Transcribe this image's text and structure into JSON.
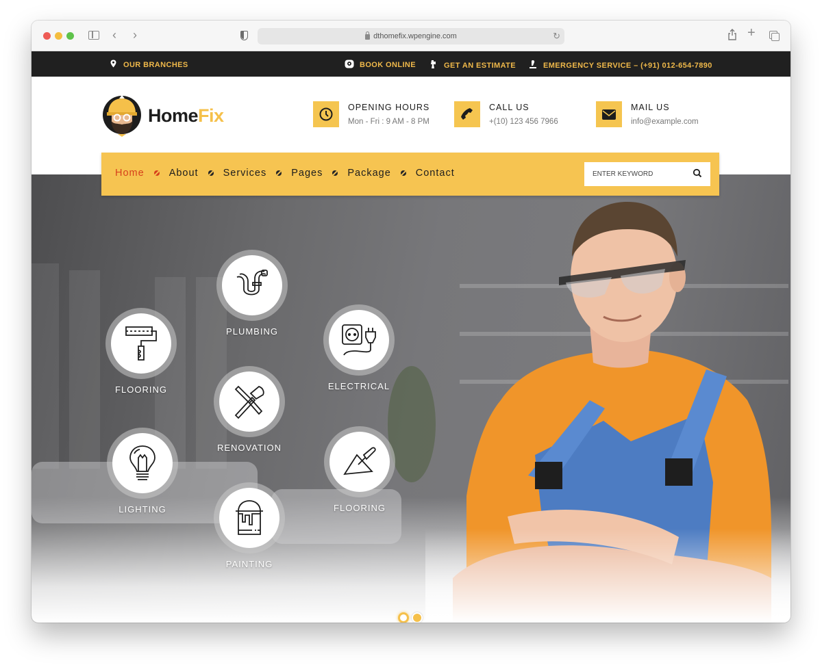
{
  "browser": {
    "url": "dthomefix.wpengine.com",
    "icons": [
      "close-dot",
      "minimize-dot",
      "zoom-dot",
      "sidebar-icon",
      "back-icon",
      "forward-icon",
      "shield-icon",
      "lock-icon",
      "reload-icon",
      "share-icon",
      "new-tab-icon",
      "tab-overview-icon"
    ]
  },
  "topbar": {
    "branches": "OUR BRANCHES",
    "book": "BOOK ONLINE",
    "estimate": "GET AN ESTIMATE",
    "emergency": "EMERGENCY SERVICE – (+91) 012-654-7890"
  },
  "header": {
    "logo_main": "Home",
    "logo_accent": "Fix",
    "info": [
      {
        "title": "OPENING HOURS",
        "sub": "Mon - Fri : 9 AM - 8 PM",
        "icon": "clock-icon"
      },
      {
        "title": "CALL US",
        "sub": "+(10) 123 456 7966",
        "icon": "phone-icon"
      },
      {
        "title": "MAIL US",
        "sub": "info@example.com",
        "icon": "mail-icon"
      }
    ]
  },
  "nav": {
    "items": [
      {
        "label": "Home",
        "active": true
      },
      {
        "label": "About"
      },
      {
        "label": "Services"
      },
      {
        "label": "Pages"
      },
      {
        "label": "Package"
      },
      {
        "label": "Contact"
      }
    ],
    "search_placeholder": "ENTER KEYWORD"
  },
  "services": [
    {
      "label": "PLUMBING",
      "icon": "pipe-icon"
    },
    {
      "label": "FLOORING",
      "icon": "paint-roller-icon"
    },
    {
      "label": "ELECTRICAL",
      "icon": "socket-plug-icon"
    },
    {
      "label": "RENOVATION",
      "icon": "tools-icon"
    },
    {
      "label": "LIGHTING",
      "icon": "light-bulb-icon"
    },
    {
      "label": "FLOORING",
      "icon": "trowel-icon"
    },
    {
      "label": "PAINTING",
      "icon": "paint-bucket-icon"
    }
  ],
  "slider": {
    "current": 1,
    "total": 2
  },
  "colors": {
    "accent": "#f6c451",
    "active_nav": "#d6401c",
    "topbar_bg": "#202020",
    "topbar_text": "#f0b94a"
  }
}
